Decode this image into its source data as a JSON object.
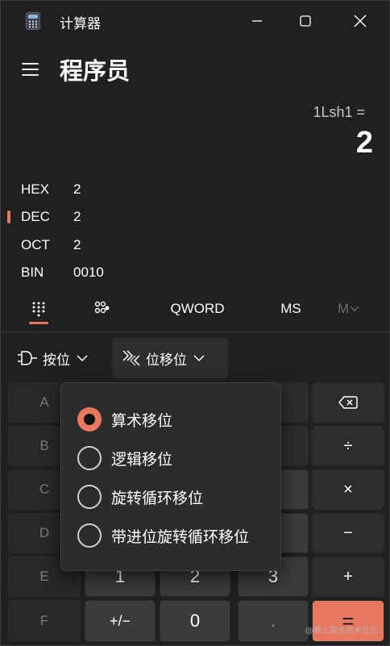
{
  "window": {
    "title": "计算器"
  },
  "header": {
    "mode_title": "程序员"
  },
  "display": {
    "expression": "1Lsh1 =",
    "result": "2"
  },
  "radix": [
    {
      "name": "HEX",
      "value": "2",
      "selected": false
    },
    {
      "name": "DEC",
      "value": "2",
      "selected": true
    },
    {
      "name": "OCT",
      "value": "2",
      "selected": false
    },
    {
      "name": "BIN",
      "value": "0010",
      "selected": false
    }
  ],
  "tabs": {
    "word_size": "QWORD",
    "memory_store": "MS",
    "memory_recall": "M"
  },
  "bitwise": {
    "bitwise_label": "按位",
    "shift_label": "位移位"
  },
  "keypad": {
    "letters": [
      "A",
      "B",
      "C",
      "D",
      "E",
      "F"
    ],
    "backspace_icon": "backspace-icon",
    "divide": "÷",
    "multiply": "×",
    "minus": "−",
    "plus": "+",
    "equals": "=",
    "one": "1",
    "two": "2",
    "three": "3",
    "negate": "+/−",
    "zero": "0",
    "decimal": "."
  },
  "shift_menu": {
    "options": [
      {
        "label": "算术移位",
        "checked": true
      },
      {
        "label": "逻辑移位",
        "checked": false
      },
      {
        "label": "旋转循环移位",
        "checked": false
      },
      {
        "label": "带进位旋转循环移位",
        "checked": false
      }
    ]
  },
  "watermark": "@稀土掘金技术社区",
  "colors": {
    "accent": "#e8775f",
    "background": "#202020",
    "key": "#2d2d2d",
    "number_key": "#3b3b3b"
  }
}
